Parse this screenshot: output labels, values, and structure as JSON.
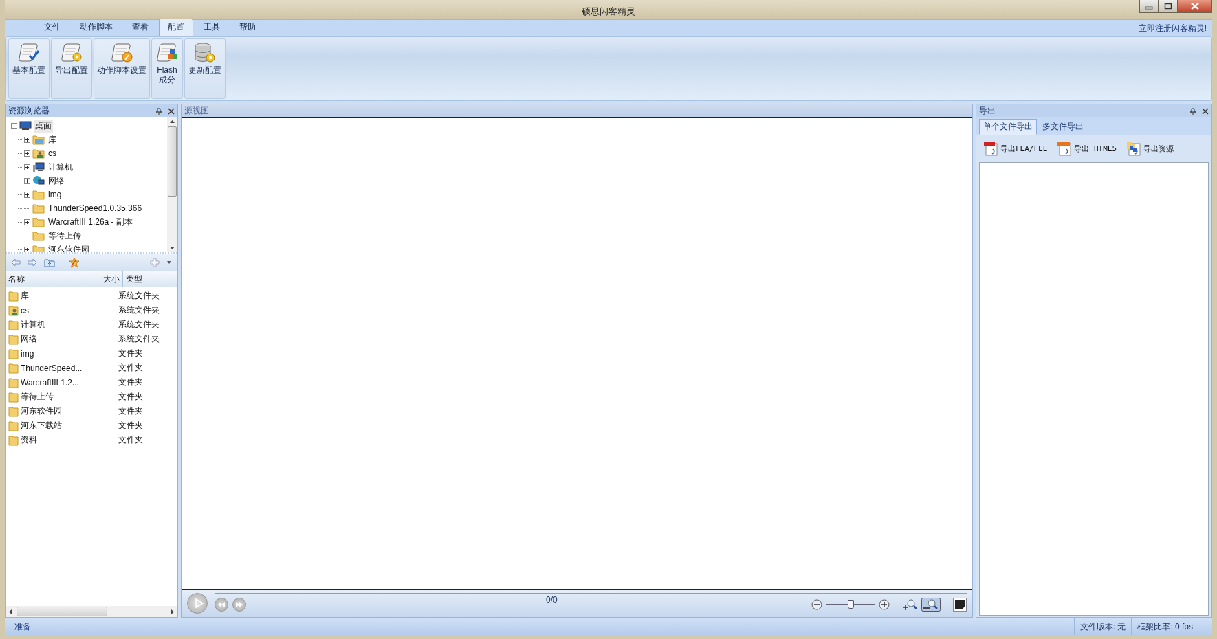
{
  "window": {
    "title": "硕思闪客精灵"
  },
  "menu": [
    {
      "label": "文件",
      "selected": false
    },
    {
      "label": "动作脚本",
      "selected": false
    },
    {
      "label": "查看",
      "selected": false
    },
    {
      "label": "配置",
      "selected": true
    },
    {
      "label": "工具",
      "selected": false
    },
    {
      "label": "帮助",
      "selected": false
    }
  ],
  "register_link": "立即注册闪客精灵!",
  "ribbon": [
    {
      "label": "基本配置",
      "kind": "check"
    },
    {
      "label": "导出配置",
      "kind": "gear"
    },
    {
      "label": "动作脚本设置",
      "kind": "wrench"
    },
    {
      "label": "Flash 成分",
      "kind": "cubes"
    },
    {
      "label": "更新配置",
      "kind": "database"
    }
  ],
  "explorer": {
    "title": "资源浏览器",
    "tree": {
      "label": "桌面",
      "selected": true,
      "expanded": true,
      "children": [
        {
          "label": "库",
          "kind": "library",
          "expandable": true,
          "selected": false
        },
        {
          "label": "cs",
          "kind": "user",
          "expandable": true,
          "selected": false
        },
        {
          "label": "计算机",
          "kind": "computer",
          "expandable": true,
          "selected": false
        },
        {
          "label": "网络",
          "kind": "network",
          "expandable": true,
          "selected": false
        },
        {
          "label": "img",
          "kind": "folder",
          "expandable": true,
          "selected": false
        },
        {
          "label": "ThunderSpeed1.0.35.366",
          "kind": "folder",
          "expandable": false,
          "selected": false
        },
        {
          "label": "WarcraftIII 1.26a - 副本",
          "kind": "folder",
          "expandable": true,
          "selected": false
        },
        {
          "label": "等待上传",
          "kind": "folder",
          "expandable": false,
          "selected": false
        },
        {
          "label": "河东软件园",
          "kind": "folder",
          "expandable": true,
          "selected": false
        }
      ]
    },
    "columns": [
      "名称",
      "大小",
      "类型"
    ],
    "files": [
      {
        "name": "库",
        "kind": "folder",
        "type": "系统文件夹"
      },
      {
        "name": "cs",
        "kind": "user",
        "type": "系统文件夹"
      },
      {
        "name": "计算机",
        "kind": "folder",
        "type": "系统文件夹"
      },
      {
        "name": "网络",
        "kind": "folder",
        "type": "系统文件夹"
      },
      {
        "name": "img",
        "kind": "folder",
        "type": "文件夹"
      },
      {
        "name": "ThunderSpeed...",
        "kind": "folder",
        "type": "文件夹"
      },
      {
        "name": "WarcraftIII 1.2...",
        "kind": "folder",
        "type": "文件夹"
      },
      {
        "name": "等待上传",
        "kind": "folder",
        "type": "文件夹"
      },
      {
        "name": "河东软件园",
        "kind": "folder",
        "type": "文件夹"
      },
      {
        "name": "河东下载站",
        "kind": "folder",
        "type": "文件夹"
      },
      {
        "name": "资料",
        "kind": "folder",
        "type": "文件夹"
      }
    ]
  },
  "source_view": {
    "title": "源视图",
    "frame_counter": "0/0",
    "zoom": {
      "level": 0.5
    }
  },
  "export": {
    "title": "导出",
    "tabs": [
      {
        "label": "单个文件导出",
        "selected": true
      },
      {
        "label": "多文件导出",
        "selected": false
      }
    ],
    "actions": [
      {
        "label": "导出FLA/FLE",
        "kind": "fla"
      },
      {
        "label": "导出 HTML5",
        "kind": "html5"
      },
      {
        "label": "导出资源",
        "kind": "resource"
      }
    ]
  },
  "status_bar": {
    "message": "准备",
    "file_version": "文件版本: 无",
    "frame_rate": "框架比率: 0 fps"
  }
}
